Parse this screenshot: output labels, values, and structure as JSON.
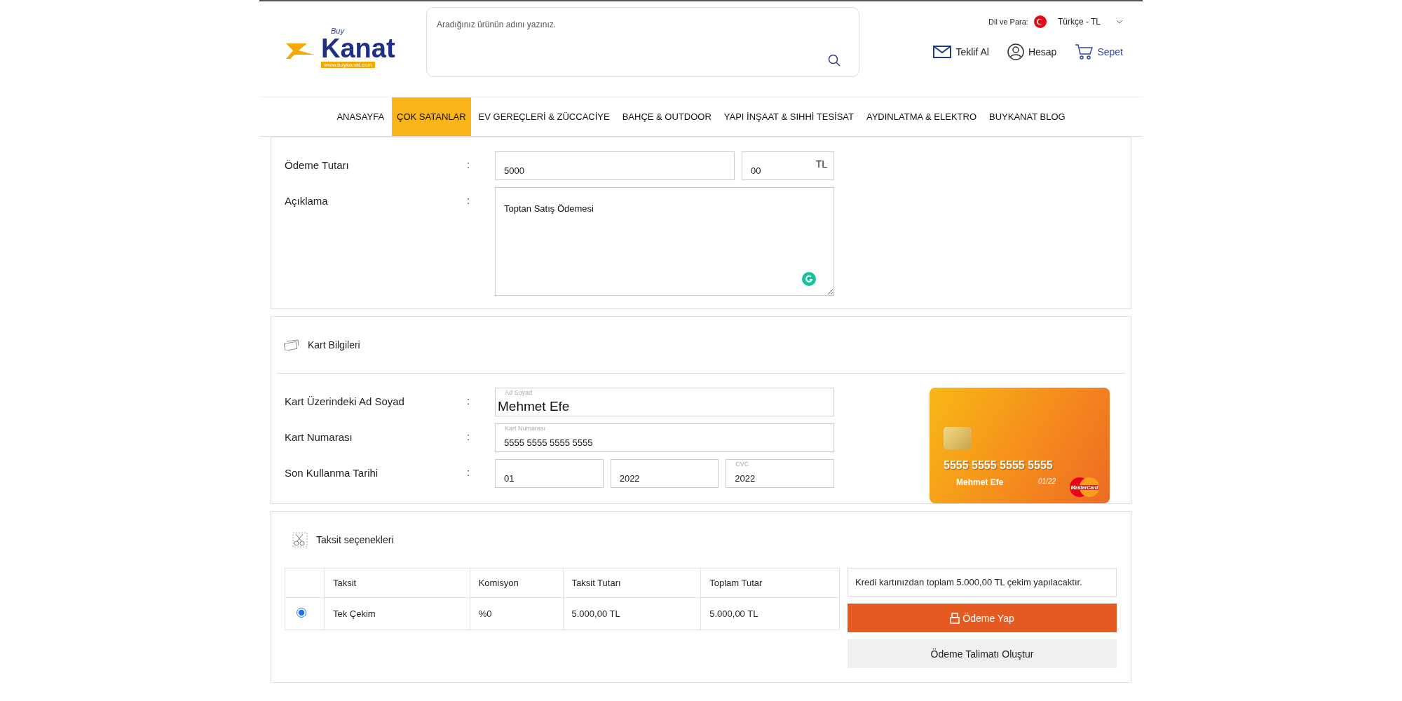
{
  "header": {
    "logo": {
      "small": "Buy",
      "brand": "Kanat",
      "url": "www.buykanat.com"
    },
    "search": {
      "placeholder": "Aradığınız ürünün adını yazınız."
    },
    "language": {
      "label": "Dil ve Para:",
      "value": "Türkçe - TL"
    },
    "actions": [
      {
        "kind": "mail",
        "label": "Teklif Al"
      },
      {
        "kind": "user",
        "label": "Hesap"
      },
      {
        "kind": "cart",
        "label": "Sepet"
      }
    ]
  },
  "nav": [
    {
      "label": "ANASAYFA",
      "selected": false
    },
    {
      "label": "ÇOK SATANLAR",
      "selected": true
    },
    {
      "label": "EV GEREÇLERİ & ZÜCCACİYE",
      "selected": false
    },
    {
      "label": "BAHÇE & OUTDOOR",
      "selected": false
    },
    {
      "label": "YAPI İNŞAAT & SIHHİ TESİSAT",
      "selected": false
    },
    {
      "label": "AYDINLATMA & ELEKTRO",
      "selected": false
    },
    {
      "label": "BUYKANAT BLOG",
      "selected": false
    }
  ],
  "payment": {
    "amount": {
      "label": "Ödeme Tutarı",
      "colon": ":",
      "value": "5000",
      "cents": "00",
      "currency": "TL"
    },
    "description": {
      "label": "Açıklama",
      "colon": ":",
      "value": "Toptan Satış Ödemesi"
    }
  },
  "card": {
    "title": "Kart Bilgileri",
    "name": {
      "label": "Kart Üzerindeki Ad Soyad",
      "colon": ":",
      "floating": "Ad Soyad",
      "value": "Mehmet Efe"
    },
    "number": {
      "label": "Kart Numarası",
      "colon": ":",
      "floating": "Kart Numarası",
      "value": "5555 5555 5555 5555"
    },
    "expiry": {
      "label": "Son Kullanma Tarihi",
      "colon": ":",
      "month": "01",
      "year": "2022",
      "cvc_label": "CVC",
      "cvc": "2022"
    },
    "preview": {
      "number": "5555 5555 5555 5555",
      "name": "Mehmet Efe",
      "expiry": "01/22",
      "brand": "MasterCard"
    }
  },
  "installments": {
    "title": "Taksit seçenekleri",
    "columns": [
      "Taksit",
      "Komisyon",
      "Taksit Tutarı",
      "Toplam Tutar"
    ],
    "rows": [
      {
        "selected": true,
        "cells": [
          "Tek Çekim",
          "%0",
          "5.000,00 TL",
          "5.000,00 TL"
        ]
      }
    ],
    "notice": "Kredi kartınızdan toplam 5.000,00 TL çekim yapılacaktır.",
    "pay_button": "Ödeme Yap",
    "order_button": "Ödeme Talimatı Oluştur"
  }
}
